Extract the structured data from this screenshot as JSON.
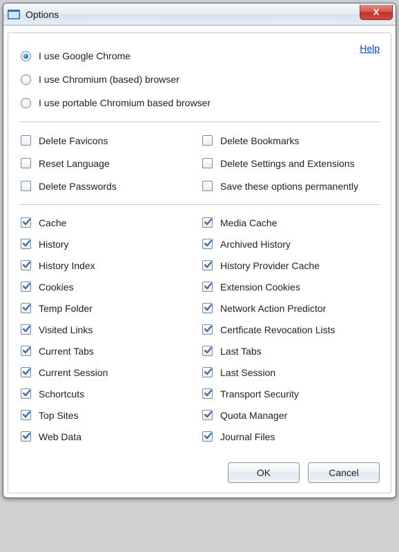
{
  "window": {
    "title": "Options",
    "close_glyph": "X"
  },
  "help": {
    "label": "Help"
  },
  "browser_radios": [
    {
      "label": "I use Google Chrome",
      "selected": true
    },
    {
      "label": "I use Chromium (based) browser",
      "selected": false
    },
    {
      "label": "I use portable Chromium based browser",
      "selected": false
    }
  ],
  "misc_options": {
    "left": [
      {
        "label": "Delete Favicons",
        "checked": false
      },
      {
        "label": "Reset Language",
        "checked": false
      },
      {
        "label": "Delete Passwords",
        "checked": false
      }
    ],
    "right": [
      {
        "label": "Delete Bookmarks",
        "checked": false
      },
      {
        "label": "Delete Settings and Extensions",
        "checked": false
      },
      {
        "label": "Save these options permanently",
        "checked": false
      }
    ]
  },
  "data_options": {
    "left": [
      {
        "label": "Cache",
        "checked": true
      },
      {
        "label": "History",
        "checked": true
      },
      {
        "label": "History Index",
        "checked": true
      },
      {
        "label": "Cookies",
        "checked": true
      },
      {
        "label": "Temp Folder",
        "checked": true
      },
      {
        "label": "Visited Links",
        "checked": true
      },
      {
        "label": "Current Tabs",
        "checked": true
      },
      {
        "label": "Current Session",
        "checked": true
      },
      {
        "label": "Schortcuts",
        "checked": true
      },
      {
        "label": "Top Sites",
        "checked": true
      },
      {
        "label": "Web Data",
        "checked": true
      }
    ],
    "right": [
      {
        "label": "Media Cache",
        "checked": true
      },
      {
        "label": "Archived History",
        "checked": true
      },
      {
        "label": "History Provider Cache",
        "checked": true
      },
      {
        "label": "Extension Cookies",
        "checked": true
      },
      {
        "label": "Network Action Predictor",
        "checked": true
      },
      {
        "label": "Certficate Revocation Lists",
        "checked": true
      },
      {
        "label": "Last Tabs",
        "checked": true
      },
      {
        "label": "Last Session",
        "checked": true
      },
      {
        "label": "Transport Security",
        "checked": true
      },
      {
        "label": "Quota Manager",
        "checked": true
      },
      {
        "label": "Journal Files",
        "checked": true
      }
    ]
  },
  "footer": {
    "ok": "OK",
    "cancel": "Cancel"
  }
}
